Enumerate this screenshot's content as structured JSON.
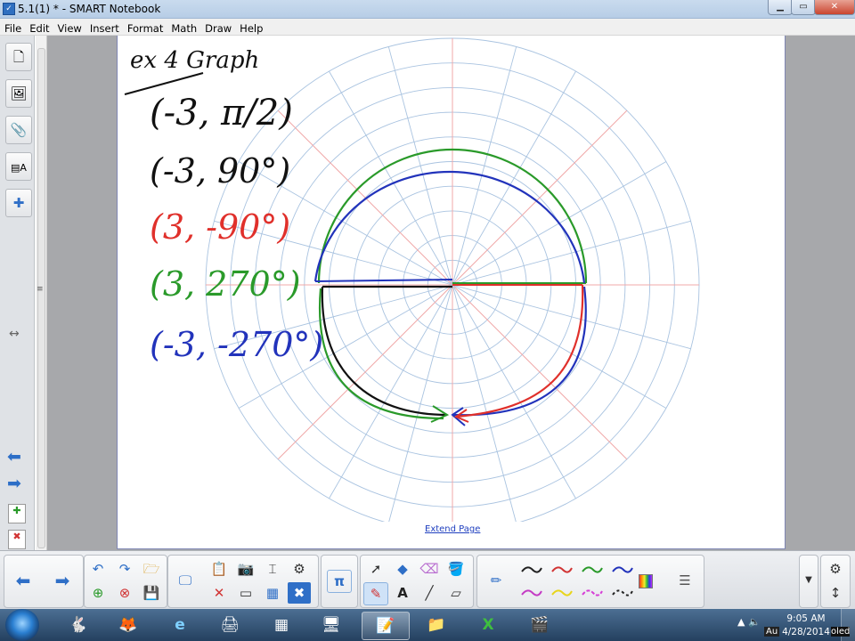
{
  "window": {
    "title": "5.1(1) * - SMART Notebook",
    "min_glyph": "▁",
    "max_glyph": "▭",
    "close_glyph": "✕"
  },
  "menu": [
    "File",
    "Edit",
    "View",
    "Insert",
    "Format",
    "Math",
    "Draw",
    "Help"
  ],
  "page": {
    "extend_label": "Extend Page",
    "heading": "ex 4 Graph",
    "lines": [
      {
        "text": "(-3, π/2)",
        "color": "#111111"
      },
      {
        "text": "(-3, 90°)",
        "color": "#111111"
      },
      {
        "text": "(3, -90°)",
        "color": "#e0302b"
      },
      {
        "text": "(3, 270°)",
        "color": "#2a9a2a"
      },
      {
        "text": "(-3, -270°)",
        "color": "#2233bb"
      }
    ]
  },
  "colors": {
    "grid": "#a9c3e0",
    "axis": "#f0a8a8",
    "ink_black": "#111111",
    "ink_red": "#e0302b",
    "ink_green": "#2a9a2a",
    "ink_blue": "#2233bb"
  },
  "toolbar": {
    "pi_label": "π",
    "text_tool_label": "A"
  },
  "taskbar": {
    "time": "9:05 AM",
    "date": "4/28/2014",
    "tray_text": "Au",
    "overflow_text": "oled"
  },
  "icons": {
    "undo": "undo-icon",
    "redo": "redo-icon",
    "pen": "pen-icon",
    "eraser": "eraser-icon",
    "settings": "gear-icon"
  }
}
